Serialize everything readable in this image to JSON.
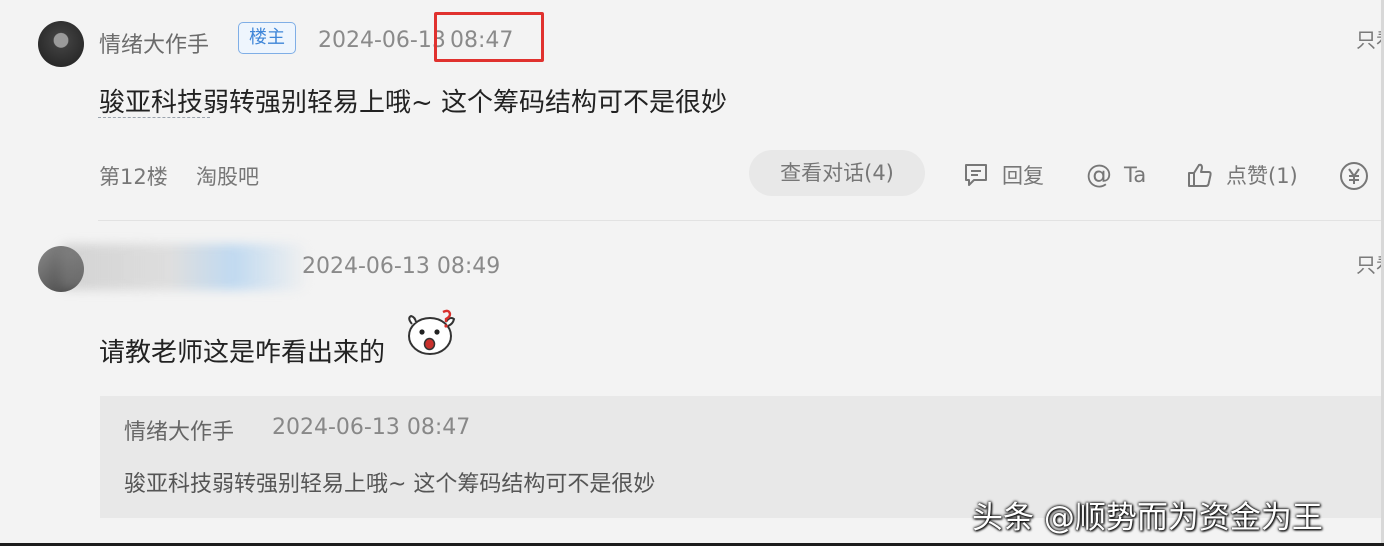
{
  "colors": {
    "accent_blue": "#3f86d8",
    "highlight_red": "#e0312e",
    "background": "#f3f3f3",
    "quote_background": "#e8e8e8"
  },
  "post": {
    "username": "情绪大作手",
    "badge": "楼主",
    "date": "2024-06-13",
    "time": "08:47",
    "only_label": "只看",
    "content": "骏亚科技弱转强别轻易上哦~ 这个筹码结构可不是很妙",
    "floor": "第12楼",
    "source": "淘股吧",
    "view_dialog": "查看对话(4)",
    "reply": "回复",
    "at_prefix": "@",
    "at_label": "Ta",
    "like": "点赞(1)",
    "reward_icon": "yen-icon"
  },
  "reply_post": {
    "timestamp": "2024-06-13 08:49",
    "only_label": "只看",
    "content": "请教老师这是咋看出来的",
    "emoji": "confused-cow-emoji",
    "quote": {
      "username": "情绪大作手",
      "timestamp": "2024-06-13 08:47",
      "content": "骏亚科技弱转强别轻易上哦~ 这个筹码结构可不是很妙"
    }
  },
  "watermark": "头条 @顺势而为资金为王"
}
